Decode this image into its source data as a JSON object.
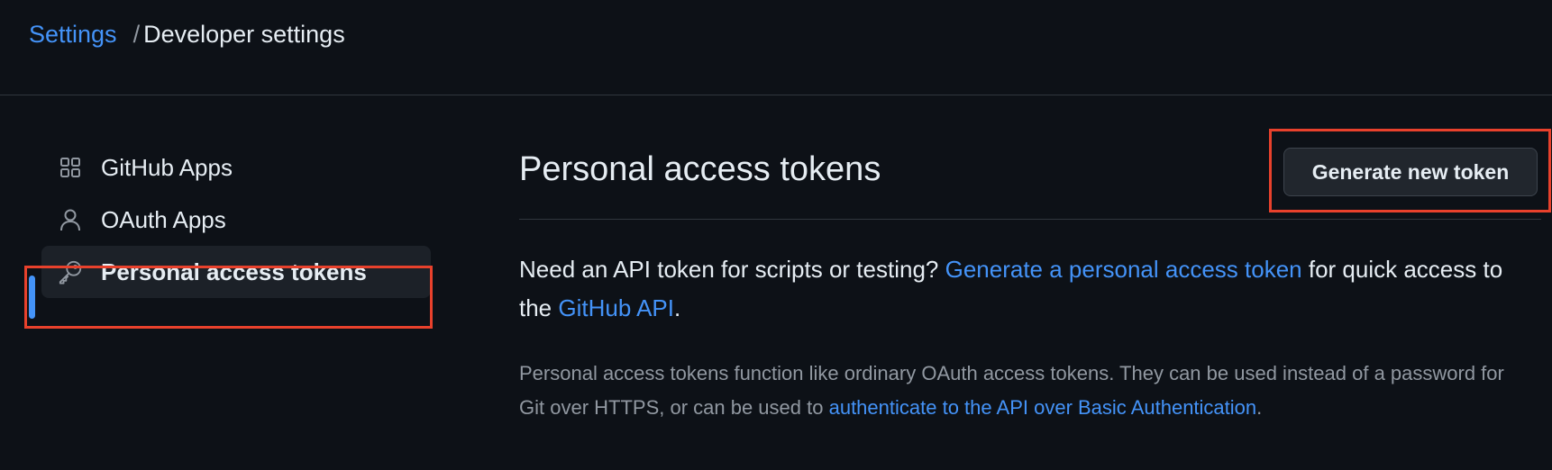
{
  "breadcrumb": {
    "parent": "Settings",
    "separator": "/",
    "current": "Developer settings"
  },
  "sidebar": {
    "items": [
      {
        "label": "GitHub Apps",
        "icon": "apps-grid-icon",
        "active": false
      },
      {
        "label": "OAuth Apps",
        "icon": "person-icon",
        "active": false
      },
      {
        "label": "Personal access tokens",
        "icon": "key-icon",
        "active": true
      }
    ]
  },
  "main": {
    "title": "Personal access tokens",
    "generate_button": "Generate new token",
    "intro": {
      "text_1": "Need an API token for scripts or testing? ",
      "link_1": "Generate a personal access token",
      "text_2": " for quick access to the ",
      "link_2": "GitHub API",
      "text_3": "."
    },
    "description": {
      "text_1": "Personal access tokens function like ordinary OAuth access tokens. They can be used instead of a password for Git over HTTPS, or can be used to ",
      "link": "authenticate to the API over Basic Authentication",
      "text_2": "."
    }
  },
  "colors": {
    "background": "#0d1117",
    "link": "#4493f8",
    "highlight": "#e8412c",
    "active_indicator": "#4493f8"
  }
}
